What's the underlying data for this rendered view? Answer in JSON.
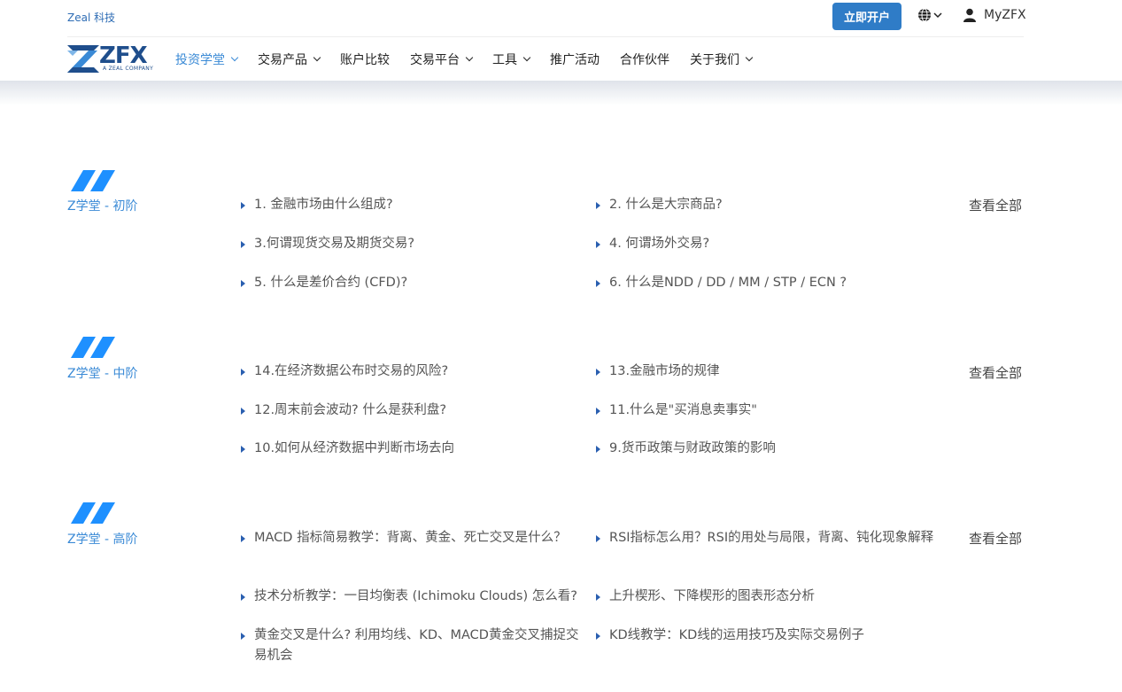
{
  "topbar": {
    "brand": "Zeal 科技",
    "open_account": "立即开户",
    "user_label": "MyZFX"
  },
  "logo": {
    "text": "ZFX",
    "subtitle": "A ZEAL COMPANY"
  },
  "nav": {
    "items": [
      {
        "label": "投资学堂",
        "dropdown": true,
        "active": true
      },
      {
        "label": "交易产品",
        "dropdown": true
      },
      {
        "label": "账户比较",
        "dropdown": false
      },
      {
        "label": "交易平台",
        "dropdown": true
      },
      {
        "label": "工具",
        "dropdown": true
      },
      {
        "label": "推广活动",
        "dropdown": false
      },
      {
        "label": "合作伙伴",
        "dropdown": false
      },
      {
        "label": "关于我们",
        "dropdown": true
      }
    ]
  },
  "sections": [
    {
      "title": "Z学堂 - 初阶",
      "view_all": "查看全部",
      "items": [
        "1. 金融市场由什么组成?",
        "2. 什么是大宗商品?",
        "3.何谓现货交易及期货交易?",
        "4. 何谓场外交易?",
        "5. 什么是差价合约 (CFD)?",
        "6. 什么是NDD / DD / MM / STP / ECN ?"
      ]
    },
    {
      "title": "Z学堂 - 中阶",
      "view_all": "查看全部",
      "items": [
        "14.在经济数据公布时交易的风险?",
        "13.金融市场的规律",
        "12.周末前会波动? 什么是获利盘?",
        "11.什么是\"买消息卖事实\"",
        "10.如何从经济数据中判断市场去向",
        "9.货币政策与财政政策的影响"
      ]
    },
    {
      "title": "Z学堂 - 高阶",
      "view_all": "查看全部",
      "items": [
        "MACD 指标简易教学：背离、黄金、死亡交叉是什么？",
        "RSI指标怎么用？RSI的用处与局限，背离、钝化现象解释",
        "技术分析教学：一目均衡表 (Ichimoku Clouds) 怎么看?",
        "上升楔形、下降楔形的图表形态分析",
        "黄金交叉是什么? 利用均线、KD、MACD黄金交叉捕捉交易机会",
        "KD线教学：KD线的运用技巧及实际交易例子"
      ]
    }
  ],
  "colors": {
    "accent": "#3a8ad6",
    "button": "#2f7cc7",
    "brand_dark": "#1f4e8c",
    "bullet": "#2a5fb0"
  }
}
